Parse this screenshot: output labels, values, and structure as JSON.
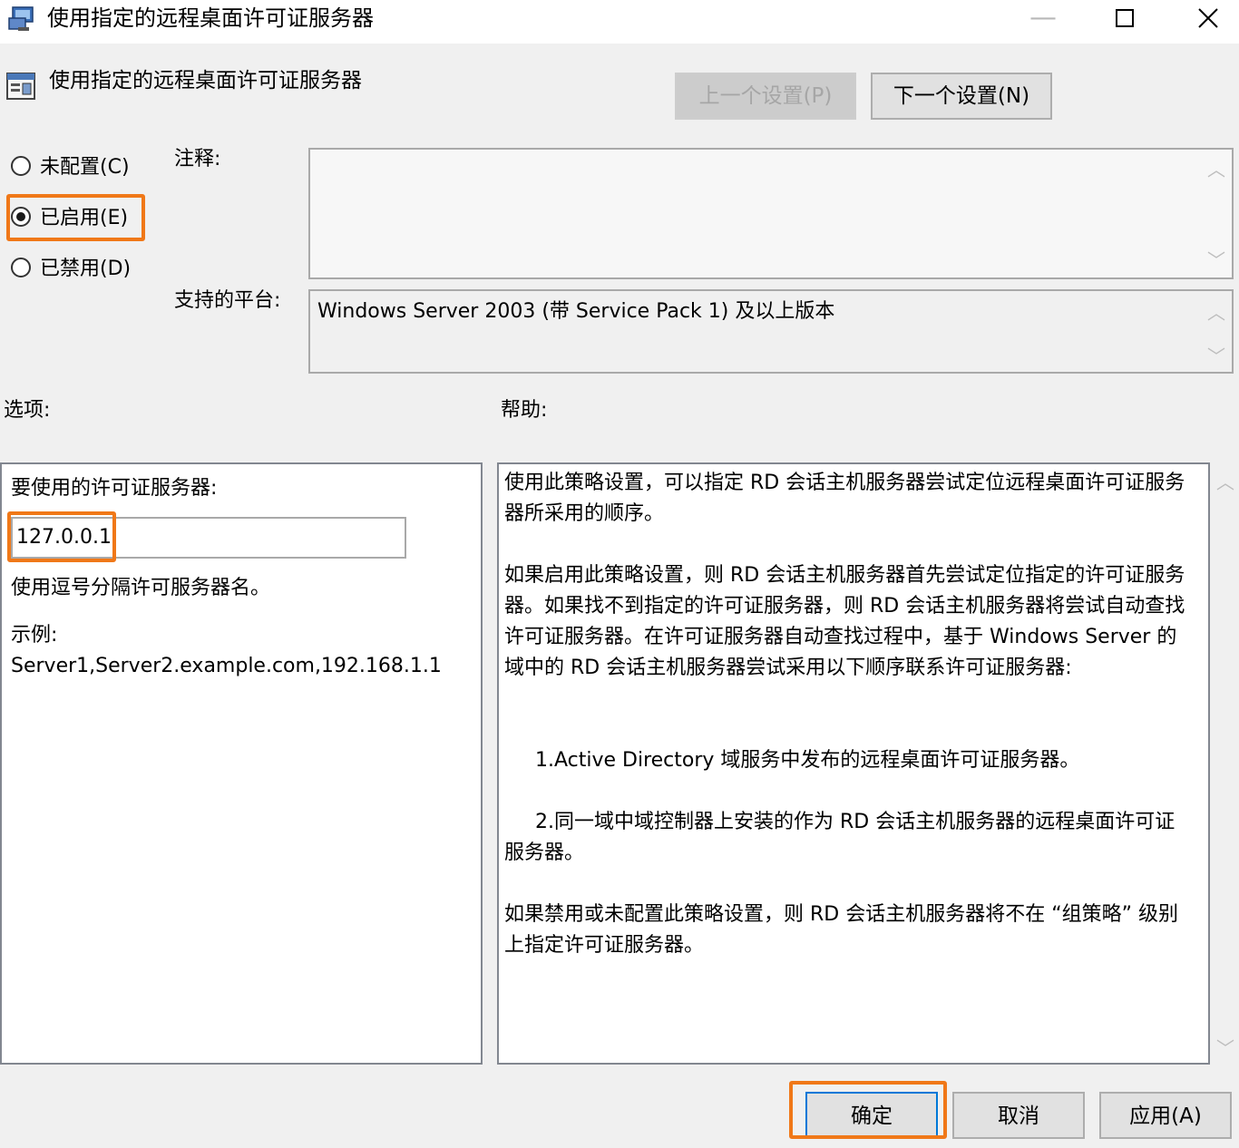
{
  "window": {
    "title": "使用指定的远程桌面许可证服务器",
    "min_glyph": "—",
    "max_glyph": "☐",
    "close_glyph": "✕"
  },
  "header": {
    "policy_name": "使用指定的远程桌面许可证服务器",
    "prev_button": "上一个设置(P)",
    "next_button": "下一个设置(N)"
  },
  "state": {
    "not_configured": "未配置(C)",
    "enabled": "已启用(E)",
    "disabled": "已禁用(D)",
    "selected": "enabled"
  },
  "comment": {
    "label": "注释:",
    "value": ""
  },
  "platform": {
    "label": "支持的平台:",
    "value": "Windows Server 2003 (带 Service Pack 1) 及以上版本"
  },
  "options": {
    "label": "选项:",
    "server_label": "要使用的许可证服务器:",
    "server_value": "127.0.0.1",
    "hint": "使用逗号分隔许可服务器名。",
    "example_label": "示例:",
    "example_value": "Server1,Server2.example.com,192.168.1.1"
  },
  "help": {
    "label": "帮助:",
    "p1": "使用此策略设置，可以指定 RD 会话主机服务器尝试定位远程桌面许可证服务器所采用的顺序。",
    "p2": "如果启用此策略设置，则 RD 会话主机服务器首先尝试定位指定的许可证服务器。如果找不到指定的许可证服务器，则 RD 会话主机服务器将尝试自动查找许可证服务器。在许可证服务器自动查找过程中，基于 Windows Server 的域中的 RD 会话主机服务器尝试采用以下顺序联系许可证服务器:",
    "p3": "1.Active Directory 域服务中发布的远程桌面许可证服务器。",
    "p4": "2.同一域中域控制器上安装的作为 RD 会话主机服务器的远程桌面许可证服务器。",
    "p5": "如果禁用或未配置此策略设置，则 RD 会话主机服务器将不在 “组策略” 级别上指定许可证服务器。"
  },
  "footer": {
    "ok": "确定",
    "cancel": "取消",
    "apply": "应用(A)"
  },
  "colors": {
    "highlight": "#f07818",
    "dialog_bg": "#f0f0f0",
    "ok_border": "#0078d7"
  }
}
